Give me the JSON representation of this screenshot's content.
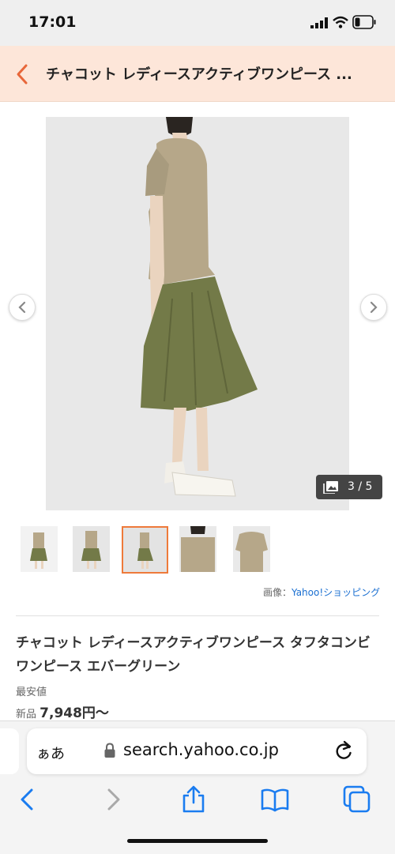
{
  "status_bar": {
    "time": "17:01",
    "battery_level": 0.3
  },
  "header": {
    "title": "チャコット レディースアクティブワンピース ..."
  },
  "gallery": {
    "counter": "3 / 5",
    "prev_icon": "chevron-left-icon",
    "next_icon": "chevron-right-icon",
    "counter_icon": "gallery-icon",
    "selected_thumbnail": 3,
    "thumbnail_count": 5
  },
  "credit": {
    "prefix": "画像：",
    "link": "Yahoo!ショッピング"
  },
  "product": {
    "title": "チャコット レディースアクティブワンピース タフタコンビワンピース エバーグリーン",
    "lowest_label": "最安値",
    "new_label": "新品",
    "price": "7,948円〜"
  },
  "browser": {
    "aa_label": "ぁあ",
    "url": "search.yahoo.co.jp",
    "toolbar_icons": [
      "back-icon",
      "forward-icon",
      "share-icon",
      "bookmarks-icon",
      "tabs-icon"
    ]
  },
  "colors": {
    "header_bg": "#fde6d9",
    "accent": "#ee7a3a",
    "link": "#1a6fd1",
    "browser_blue": "#1a7cf0",
    "top": "#b6a789",
    "skirt": "#737a48"
  }
}
